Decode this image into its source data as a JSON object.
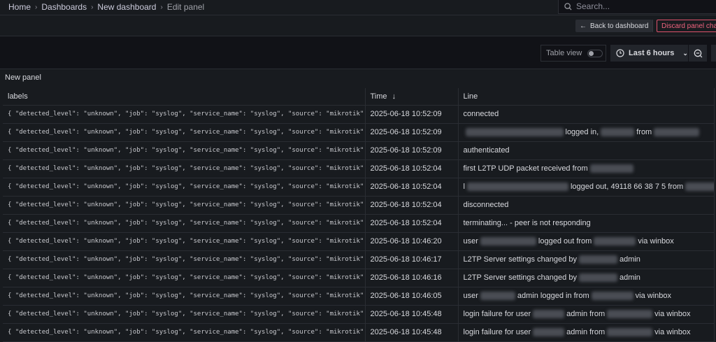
{
  "breadcrumb": [
    "Home",
    "Dashboards",
    "New dashboard",
    "Edit panel"
  ],
  "search": {
    "placeholder": "Search..."
  },
  "toolbar": {
    "back_label": "Back to dashboard",
    "discard_label": "Discard panel changes"
  },
  "controls": {
    "table_view_label": "Table view",
    "table_view_on": false,
    "time_range": "Last 6 hours"
  },
  "panel": {
    "title": "New panel",
    "columns": [
      "labels",
      "Time",
      "Line"
    ],
    "sort": {
      "column": "Time",
      "direction": "desc"
    },
    "rows": [
      {
        "labels": "{ \"detected_level\": \"unknown\", \"job\": \"syslog\", \"service_name\": \"syslog\", \"source\": \"mikrotik\" }",
        "time": "2025-06-18 10:52:09",
        "line": [
          "connected"
        ]
      },
      {
        "labels": "{ \"detected_level\": \"unknown\", \"job\": \"syslog\", \"service_name\": \"syslog\", \"source\": \"mikrotik\" }",
        "time": "2025-06-18 10:52:09",
        "line": [
          "",
          "logged in,",
          "from",
          ""
        ]
      },
      {
        "labels": "{ \"detected_level\": \"unknown\", \"job\": \"syslog\", \"service_name\": \"syslog\", \"source\": \"mikrotik\" }",
        "time": "2025-06-18 10:52:09",
        "line": [
          "authenticated"
        ]
      },
      {
        "labels": "{ \"detected_level\": \"unknown\", \"job\": \"syslog\", \"service_name\": \"syslog\", \"source\": \"mikrotik\" }",
        "time": "2025-06-18 10:52:04",
        "line": [
          "first L2TP UDP packet received from",
          ""
        ]
      },
      {
        "labels": "{ \"detected_level\": \"unknown\", \"job\": \"syslog\", \"service_name\": \"syslog\", \"source\": \"mikrotik\" }",
        "time": "2025-06-18 10:52:04",
        "line": [
          "l",
          "logged out, 49118 66 38 7 5 from",
          "..."
        ]
      },
      {
        "labels": "{ \"detected_level\": \"unknown\", \"job\": \"syslog\", \"service_name\": \"syslog\", \"source\": \"mikrotik\" }",
        "time": "2025-06-18 10:52:04",
        "line": [
          "disconnected"
        ]
      },
      {
        "labels": "{ \"detected_level\": \"unknown\", \"job\": \"syslog\", \"service_name\": \"syslog\", \"source\": \"mikrotik\" }",
        "time": "2025-06-18 10:52:04",
        "line": [
          "terminating... - peer is not responding"
        ]
      },
      {
        "labels": "{ \"detected_level\": \"unknown\", \"job\": \"syslog\", \"service_name\": \"syslog\", \"source\": \"mikrotik\" }",
        "time": "2025-06-18 10:46:20",
        "line": [
          "user",
          "logged out from",
          "via winbox"
        ]
      },
      {
        "labels": "{ \"detected_level\": \"unknown\", \"job\": \"syslog\", \"service_name\": \"syslog\", \"source\": \"mikrotik\" }",
        "time": "2025-06-18 10:46:17",
        "line": [
          "L2TP Server settings changed by",
          "admin"
        ]
      },
      {
        "labels": "{ \"detected_level\": \"unknown\", \"job\": \"syslog\", \"service_name\": \"syslog\", \"source\": \"mikrotik\" }",
        "time": "2025-06-18 10:46:16",
        "line": [
          "L2TP Server settings changed by",
          "admin"
        ]
      },
      {
        "labels": "{ \"detected_level\": \"unknown\", \"job\": \"syslog\", \"service_name\": \"syslog\", \"source\": \"mikrotik\" }",
        "time": "2025-06-18 10:46:05",
        "line": [
          "user",
          "admin logged in from",
          "via winbox"
        ]
      },
      {
        "labels": "{ \"detected_level\": \"unknown\", \"job\": \"syslog\", \"service_name\": \"syslog\", \"source\": \"mikrotik\" }",
        "time": "2025-06-18 10:45:48",
        "line": [
          "login failure for user",
          "admin from",
          "via winbox"
        ]
      },
      {
        "labels": "{ \"detected_level\": \"unknown\", \"job\": \"syslog\", \"service_name\": \"syslog\", \"source\": \"mikrotik\" }",
        "time": "2025-06-18 10:45:48",
        "line": [
          "login failure for user",
          "admin from",
          "via winbox"
        ]
      }
    ]
  }
}
